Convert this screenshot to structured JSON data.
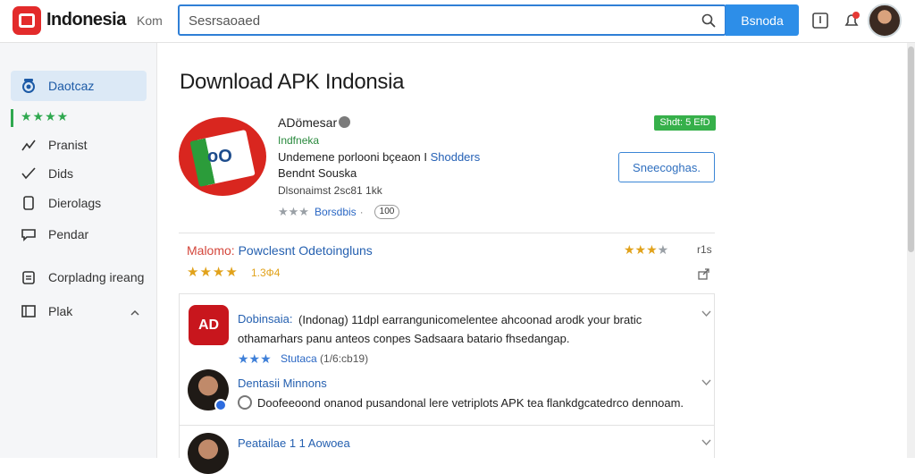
{
  "header": {
    "brand": "Indonesia",
    "brand_sub": "Kom",
    "search_placeholder": "Sesrsaoaed",
    "search_button": "Bsnoda"
  },
  "sidebar": {
    "items": [
      {
        "label": "Daotcaz",
        "icon": "apps-icon"
      },
      {
        "label": "★★★★",
        "icon": "star-icon"
      },
      {
        "label": "Pranist",
        "icon": "trending-icon"
      },
      {
        "label": "Dids",
        "icon": "check-icon"
      },
      {
        "label": "Dierolags",
        "icon": "file-icon"
      },
      {
        "label": "Pendar",
        "icon": "chat-icon"
      },
      {
        "label": "Corpladng ireang",
        "icon": "clipboard-icon"
      },
      {
        "label": "Plak",
        "icon": "grid-icon"
      }
    ]
  },
  "main": {
    "title": "Download APK Indonsia",
    "app": {
      "name": "ADömesar",
      "category": "Indfneka",
      "desc_text": "Undemene porlooni bçeaon I",
      "desc_link": "Shodders",
      "developer": "Bendnt Souska",
      "size": "Dlsonaimst 2sc81 1kk",
      "rating_link": "Borsdbis",
      "rating_pill": "100",
      "badge": "Shdt: 5 EfD",
      "action_button": "Sneecoghas."
    },
    "section": {
      "title_red": "Malomo:",
      "title_blue": "Powclesnt Odetoingluns",
      "stars": "★★★★",
      "score": "1.3Ф4",
      "right_count": "r1s"
    },
    "reviews": [
      {
        "name": "Dobinsaia:",
        "text": "(Indonag) 11dpl earrangunicomelentee ahcoonad arodk your bratic othamarhars panu anteos conpes Sadsaara batario fhsedangap.",
        "stars": "★★★",
        "meta_link": "Stutaca",
        "meta": "(1/6:cb19)",
        "logo_text": "AD"
      },
      {
        "name": "Dentasii Minnons",
        "text": "Doofeeoond onanod pusandonal lere vetriplots APK tea flankdgcatedrco dennoam."
      },
      {
        "name": "Peatailae 1 1 Aowoea",
        "text": ""
      }
    ]
  }
}
